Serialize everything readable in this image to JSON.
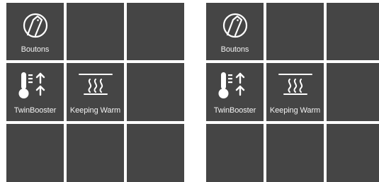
{
  "colors": {
    "tile_background": "#454545",
    "page_background": "#ffffff",
    "text": "#f2f2f2",
    "icon": "#ffffff"
  },
  "panels": [
    {
      "tiles": [
        {
          "label": "Boutons",
          "icon": "buttons-icon"
        },
        {
          "label": "",
          "icon": ""
        },
        {
          "label": "",
          "icon": ""
        },
        {
          "label": "TwinBooster",
          "icon": "thermometer-boost-icon"
        },
        {
          "label": "Keeping Warm",
          "icon": "keeping-warm-icon"
        },
        {
          "label": "",
          "icon": ""
        },
        {
          "label": "",
          "icon": ""
        },
        {
          "label": "",
          "icon": ""
        },
        {
          "label": "",
          "icon": ""
        }
      ]
    },
    {
      "tiles": [
        {
          "label": "Boutons",
          "icon": "buttons-icon"
        },
        {
          "label": "",
          "icon": ""
        },
        {
          "label": "",
          "icon": ""
        },
        {
          "label": "TwinBooster",
          "icon": "thermometer-boost-icon"
        },
        {
          "label": "Keeping Warm",
          "icon": "keeping-warm-icon"
        },
        {
          "label": "",
          "icon": ""
        },
        {
          "label": "",
          "icon": ""
        },
        {
          "label": "",
          "icon": ""
        },
        {
          "label": "",
          "icon": ""
        }
      ]
    }
  ]
}
